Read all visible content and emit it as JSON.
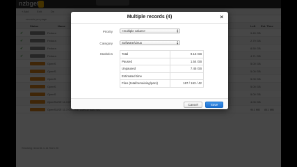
{
  "background": {
    "logo": "nzbget",
    "toolbar": [
      "+ Add",
      "Edit",
      "Dn"
    ],
    "subtoolbar": "records per page",
    "table_headers": {
      "status": "Status",
      "name": "Name",
      "left": "Left",
      "est_time": "Est. Time"
    },
    "rows": [
      {
        "name": "Fedora",
        "left": "9.45 GB",
        "est": ""
      },
      {
        "name": "Fedora",
        "left": "2.79 GB",
        "est": ""
      },
      {
        "name": "Fedora",
        "left": "8.50 GB",
        "est": ""
      },
      {
        "name": "Fedora",
        "left": "4.71 GB",
        "est": ""
      },
      {
        "name": "OpenS",
        "left": "5.00 GB",
        "est": ""
      },
      {
        "name": "OpenS",
        "left": "5.00 GB",
        "est": ""
      },
      {
        "name": "OpenS",
        "left": "5.00 GB",
        "est": ""
      },
      {
        "name": "OpenS",
        "left": "5.00 GB",
        "est": ""
      },
      {
        "name": "OpenS",
        "left": "5.00 GB",
        "est": ""
      },
      {
        "name": "OpenSUSE 11.3 DVD",
        "left": "4.00 GB",
        "est": ""
      },
      {
        "name": "OpenSUSE 11.3 GNOME LiveCD i686 ISO",
        "left": "941 MB",
        "est": "841 MB"
      }
    ],
    "footer": "Showing records 1-11 from 20"
  },
  "modal": {
    "title": "Multiple records (4)",
    "close": "×",
    "priority_label": "Priority",
    "priority_value": "<multiple values>",
    "category_label": "Category",
    "category_value": "Software/Linux",
    "statistics_label": "Statistics",
    "stats": [
      {
        "label": "Total",
        "value": "9.16 GB"
      },
      {
        "label": "Paused",
        "value": "1.54 GB"
      },
      {
        "label": "Unpaused",
        "value": "7.45 GB"
      },
      {
        "label": "Estimated time",
        "value": ""
      },
      {
        "label": "Files (total/remaining/pars)",
        "value": "167 / 163 / 42"
      }
    ],
    "cancel": "Cancel",
    "save": "Save"
  },
  "colors": {
    "accent": "#1f6fd0",
    "badge": "#e08a1e",
    "badge_gray": "#888888"
  }
}
